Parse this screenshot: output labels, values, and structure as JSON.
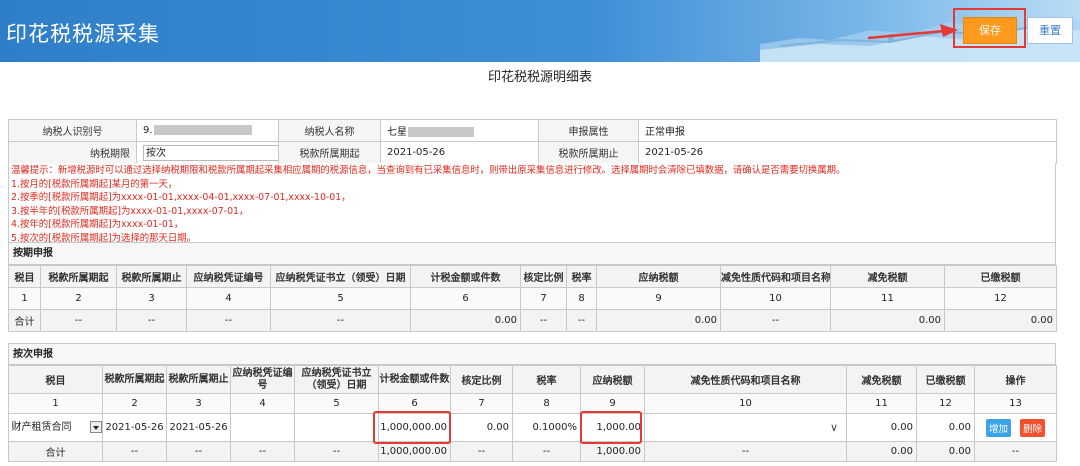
{
  "header": {
    "title": "印花税税源采集",
    "save_label": "保存",
    "reset_label": "重置"
  },
  "page_title": "印花税税源明细表",
  "info": {
    "taxpayer_id_label": "纳税人识别号",
    "taxpayer_id_value": "9.",
    "taxpayer_name_label": "纳税人名称",
    "taxpayer_name_value": "七星",
    "report_attr_label": "申报属性",
    "report_attr_value": "正常申报",
    "period_label": "纳税期限",
    "period_value": "按次",
    "start_label": "税款所属期起",
    "start_value": "2021-05-26",
    "end_label": "税款所属期止",
    "end_value": "2021-05-26"
  },
  "tips": {
    "line0": "温馨提示：新增税源时可以通过选择纳税期限和税款所属期起采集相应属期的税源信息，当查询到有已采集信息时，则带出原采集信息进行修改。选择属期时会清除已填数据，请确认是否需要切换属期。",
    "line1": "1.按月的[税款所属期起]某月的第一天，",
    "line2": "2.按季的[税款所属期起]为xxxx-01-01,xxxx-04-01,xxxx-07-01,xxxx-10-01，",
    "line3": "3.按半年的[税款所属期起]为xxxx-01-01,xxxx-07-01，",
    "line4": "4.按年的[税款所属期起]为xxxx-01-01，",
    "line5": "5.按次的[税款所属期起]为选择的那天日期。"
  },
  "periodic": {
    "section_label": "按期申报",
    "headers": [
      "税目",
      "税款所属期起",
      "税款所属期止",
      "应纳税凭证编号",
      "应纳税凭证书立（领受）日期",
      "计税金额或件数",
      "核定比例",
      "税率",
      "应纳税额",
      "减免性质代码和项目名称",
      "减免税额",
      "已缴税额"
    ],
    "numbers": [
      "1",
      "2",
      "3",
      "4",
      "5",
      "6",
      "7",
      "8",
      "9",
      "10",
      "11",
      "12"
    ],
    "total": [
      "合计",
      "--",
      "--",
      "--",
      "--",
      "0.00",
      "--",
      "--",
      "0.00",
      "--",
      "0.00",
      "0.00"
    ]
  },
  "per_time": {
    "section_label": "按次申报",
    "headers": [
      "税目",
      "税款所属期起",
      "税款所属期止",
      "应纳税凭证编号",
      "应纳税凭证书立（领受）日期",
      "计税金额或件数",
      "核定比例",
      "税率",
      "应纳税额",
      "减免性质代码和项目名称",
      "减免税额",
      "已缴税额",
      "操作"
    ],
    "numbers": [
      "1",
      "2",
      "3",
      "4",
      "5",
      "6",
      "7",
      "8",
      "9",
      "10",
      "11",
      "12",
      "13"
    ],
    "row": {
      "tax_item": "财产租赁合同",
      "start": "2021-05-26",
      "end": "2021-05-26",
      "voucher_no": "",
      "voucher_date": "",
      "amount": "1,000,000.00",
      "ratio": "0.00",
      "rate": "0.1000%",
      "tax_payable": "1,000.00",
      "exempt_code": "",
      "exempt_amount": "0.00",
      "paid": "0.00",
      "add_label": "增加",
      "delete_label": "删除"
    },
    "total": [
      "合计",
      "--",
      "--",
      "--",
      "--",
      "1,000,000.00",
      "--",
      "--",
      "1,000.00",
      "--",
      "0.00",
      "0.00",
      "--"
    ]
  }
}
